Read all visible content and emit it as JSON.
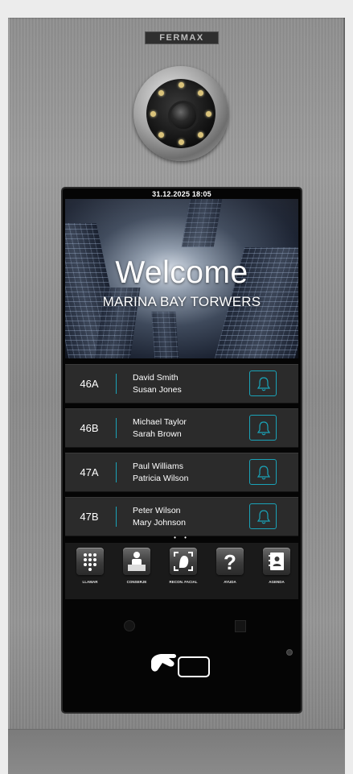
{
  "brand": "FERMAX",
  "status": {
    "datetime": "31.12.2025  18:05"
  },
  "hero": {
    "title": "Welcome",
    "subtitle": "MARINA BAY TORWERS"
  },
  "directory": [
    {
      "apartment": "46A",
      "names": [
        "David Smith",
        "Susan Jones"
      ],
      "icon": "bell-icon"
    },
    {
      "apartment": "46B",
      "names": [
        "Michael Taylor",
        "Sarah Brown"
      ],
      "icon": "bell-icon"
    },
    {
      "apartment": "47A",
      "names": [
        "Paul Williams",
        "Patricia Wilson"
      ],
      "icon": "bell-icon"
    },
    {
      "apartment": "47B",
      "names": [
        "Peter Wilson",
        "Mary Johnson"
      ],
      "icon": "bell-icon"
    }
  ],
  "pager": "• •",
  "menu": [
    {
      "label": "LLAMAR",
      "icon": "keypad-icon"
    },
    {
      "label": "CONSERJE",
      "icon": "concierge-icon"
    },
    {
      "label": "RECON. FACIAL",
      "icon": "face-recognition-icon"
    },
    {
      "label": "AYUDA",
      "icon": "help-icon"
    },
    {
      "label": "AGENDA",
      "icon": "contacts-book-icon"
    }
  ],
  "colors": {
    "accent": "#1aa3b8",
    "screen_bg": "#050505",
    "row_bg": "#2b2b2b"
  }
}
